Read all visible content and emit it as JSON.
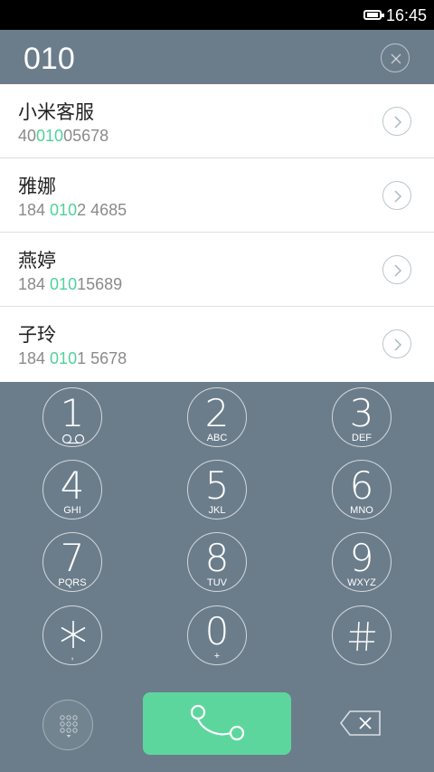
{
  "status_bar": {
    "time": "16:45",
    "battery_icon": "battery-full-icon"
  },
  "dialer": {
    "dialed_number": "010",
    "clear_icon": "close-icon"
  },
  "results": [
    {
      "name": "小米客服",
      "number_prefix": "40",
      "number_match": "010",
      "number_suffix": "05678",
      "detail_icon": "chevron-right-icon"
    },
    {
      "name": "雅娜",
      "number_prefix": "184 ",
      "number_match": "010",
      "number_suffix": "2 4685",
      "detail_icon": "chevron-right-icon"
    },
    {
      "name": "燕婷",
      "number_prefix": "184 ",
      "number_match": "010",
      "number_suffix": "15689",
      "detail_icon": "chevron-right-icon"
    },
    {
      "name": "子玲",
      "number_prefix": "184 ",
      "number_match": "010",
      "number_suffix": "1 5678",
      "detail_icon": "chevron-right-icon"
    }
  ],
  "keypad": {
    "keys": [
      {
        "digit": "1",
        "letters": "",
        "sub_icon": "voicemail-icon"
      },
      {
        "digit": "2",
        "letters": "ABC"
      },
      {
        "digit": "3",
        "letters": "DEF"
      },
      {
        "digit": "4",
        "letters": "GHI"
      },
      {
        "digit": "5",
        "letters": "JKL"
      },
      {
        "digit": "6",
        "letters": "MNO"
      },
      {
        "digit": "7",
        "letters": "PQRS"
      },
      {
        "digit": "8",
        "letters": "TUV"
      },
      {
        "digit": "9",
        "letters": "WXYZ"
      },
      {
        "digit": "*",
        "letters": ","
      },
      {
        "digit": "0",
        "letters": "+"
      },
      {
        "digit": "#",
        "letters": ""
      }
    ]
  },
  "bottom_bar": {
    "dialpad_toggle_icon": "dialpad-icon",
    "call_icon": "phone-icon",
    "backspace_icon": "backspace-icon"
  },
  "colors": {
    "background": "#6b7d8b",
    "accent_green": "#5dd69e",
    "match_highlight": "#4fd29a"
  }
}
